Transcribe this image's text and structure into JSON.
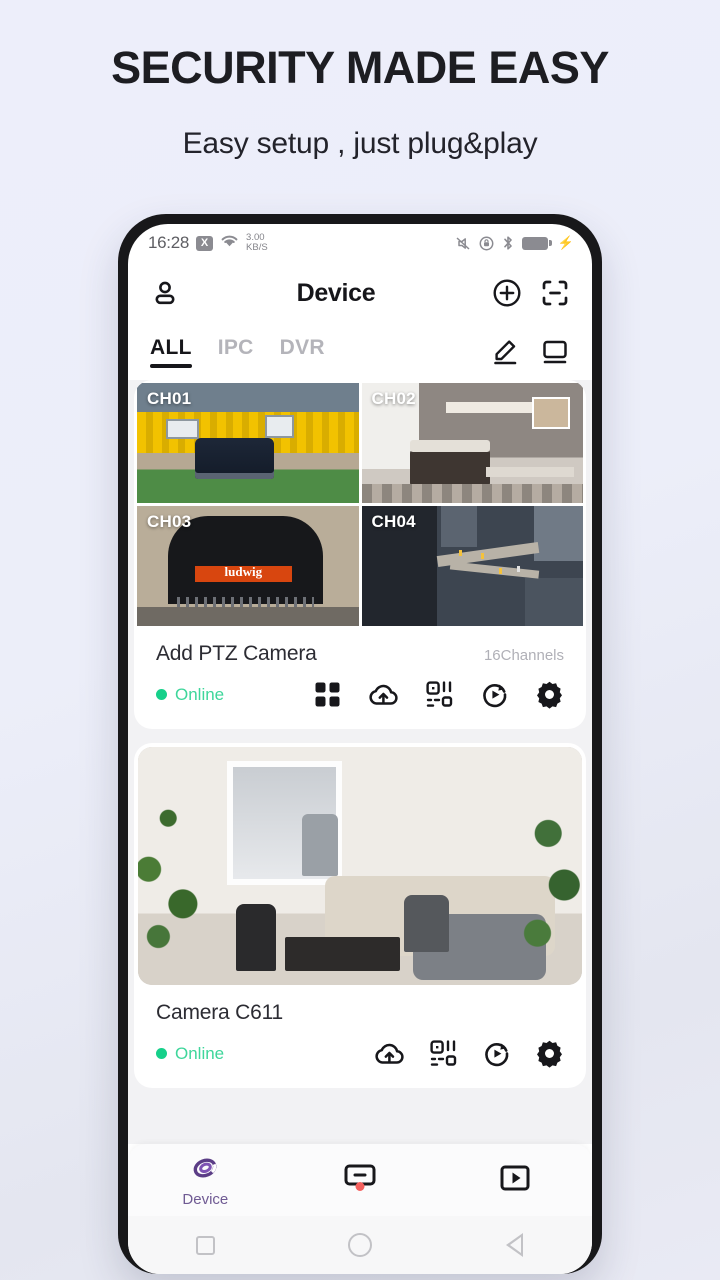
{
  "promo": {
    "title": "SECURITY MADE EASY",
    "subtitle": "Easy setup , just plug&play"
  },
  "statusbar": {
    "time": "16:28",
    "xbox_label": "X",
    "net_speed_value": "3.00",
    "net_speed_unit": "KB/S",
    "icons": [
      "wifi-icon",
      "vibrate-icon",
      "alarm-icon",
      "bluetooth-icon",
      "battery-charging-icon"
    ]
  },
  "appbar": {
    "title": "Device",
    "profile_icon": "person-icon",
    "add_icon": "plus-circle-icon",
    "scan_icon": "scan-frame-icon"
  },
  "tabs": {
    "items": [
      {
        "label": "ALL",
        "active": true
      },
      {
        "label": "IPC",
        "active": false
      },
      {
        "label": "DVR",
        "active": false
      }
    ],
    "edit_icon": "pencil-icon",
    "display_icon": "monitor-icon"
  },
  "devices": [
    {
      "name": "Add PTZ Camera",
      "channels_label": "16Channels",
      "status": "Online",
      "status_color": "#3fd69b",
      "type": "nvr",
      "channels": [
        {
          "label": "CH01",
          "scene": "yellow-house-van"
        },
        {
          "label": "CH02",
          "scene": "bedroom"
        },
        {
          "label": "CH03",
          "scene": "ludwig-storefront"
        },
        {
          "label": "CH04",
          "scene": "aerial-city"
        }
      ],
      "scene_text": {
        "ch03_sign": "ludwig"
      },
      "actions": [
        "grid-view-icon",
        "cloud-upload-icon",
        "qr-scan-icon",
        "playback-icon",
        "settings-gear-icon"
      ]
    },
    {
      "name": "Camera C611",
      "channels_label": "",
      "status": "Online",
      "status_color": "#3fd69b",
      "type": "ipc",
      "hero_scene": "living-room-people",
      "actions": [
        "cloud-upload-icon",
        "qr-scan-icon",
        "playback-icon",
        "settings-gear-icon"
      ]
    }
  ],
  "bottom_nav": {
    "items": [
      {
        "label": "Device",
        "icon": "spiral-logo-icon",
        "active": true,
        "badge": false
      },
      {
        "label": "",
        "icon": "message-bubble-icon",
        "active": false,
        "badge": true
      },
      {
        "label": "",
        "icon": "play-square-icon",
        "active": false,
        "badge": false
      }
    ],
    "active_color": "#6f5a93"
  },
  "android_nav": {
    "recents": "square-icon",
    "home": "circle-icon",
    "back": "triangle-back-icon"
  }
}
